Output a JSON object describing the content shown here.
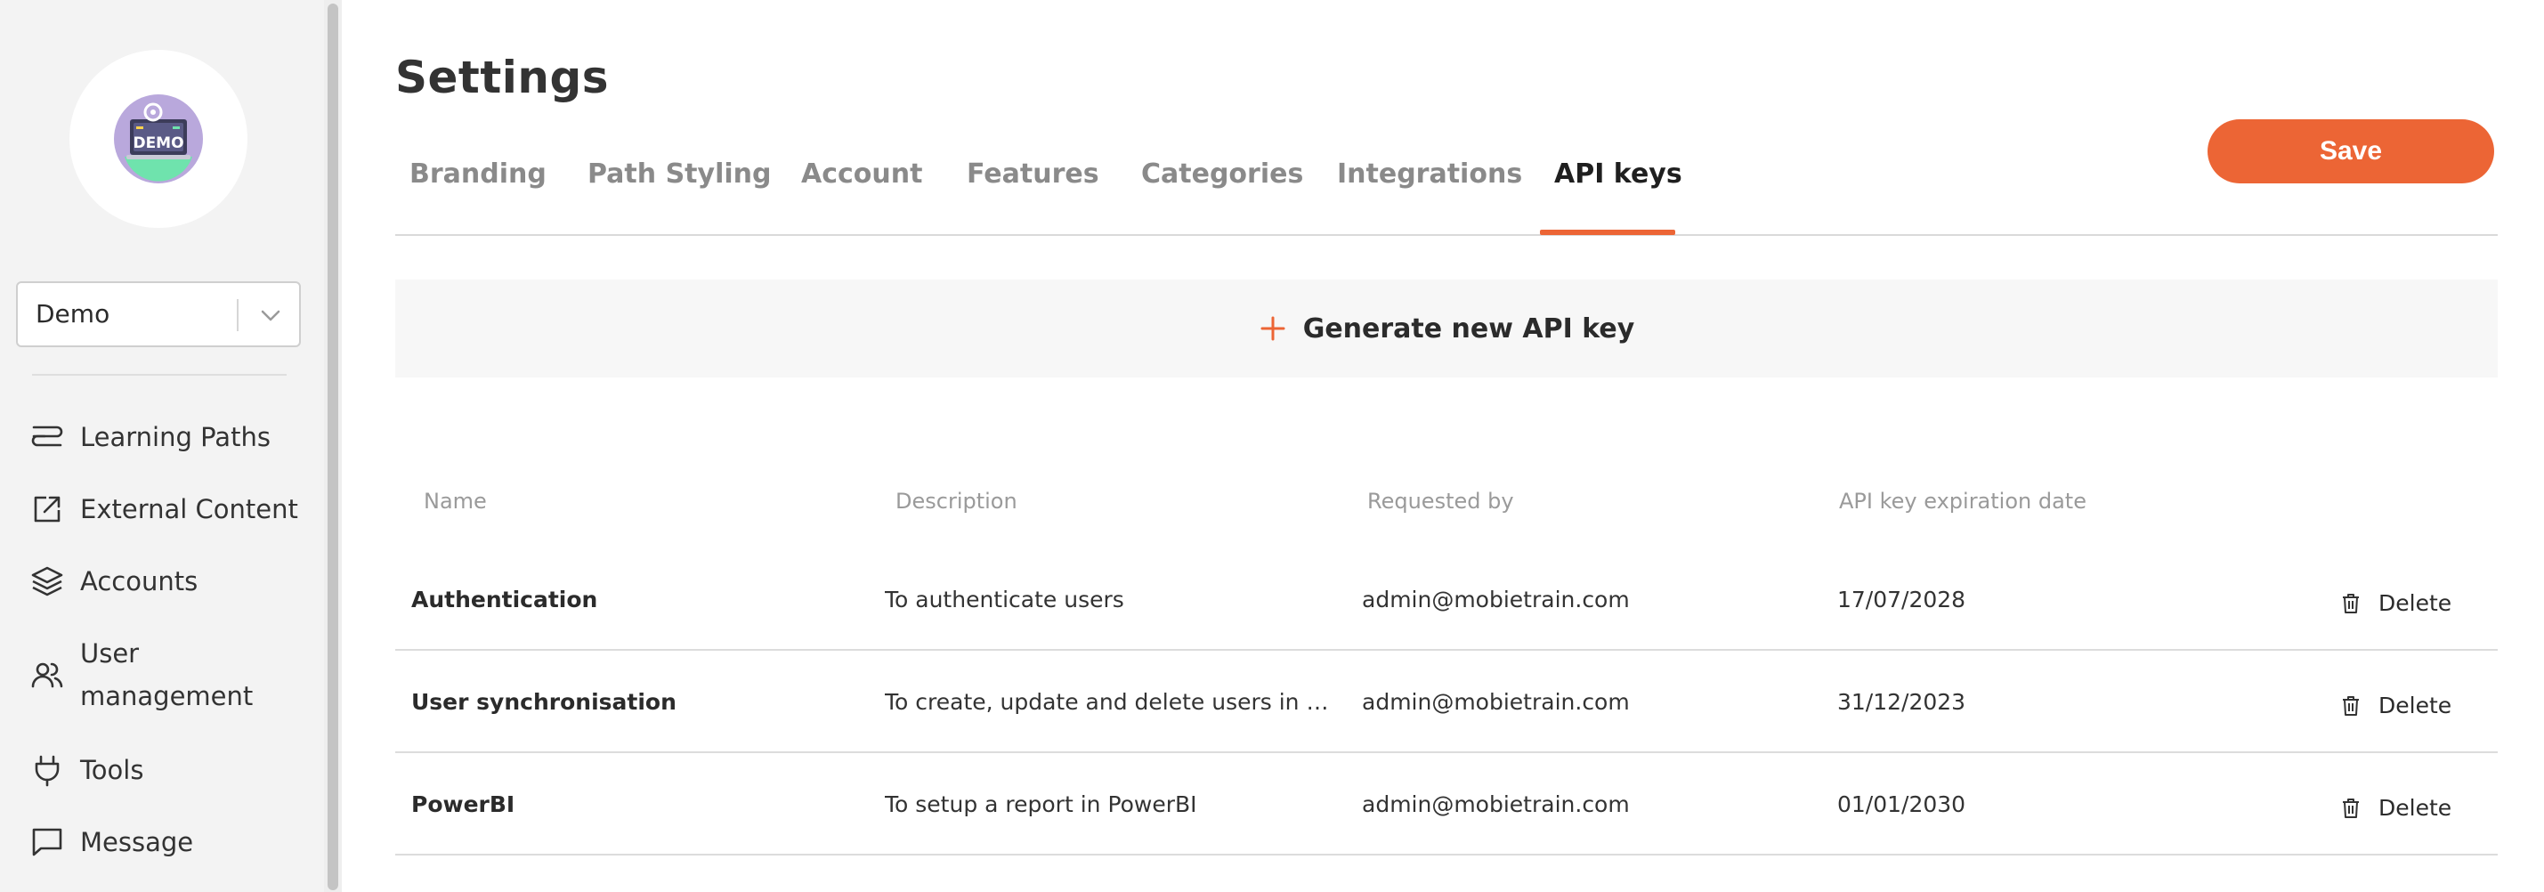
{
  "sidebar": {
    "logo_text": "DEMO",
    "workspace": {
      "selected": "Demo"
    },
    "items": [
      {
        "label": "Learning Paths",
        "icon": "learning-paths-icon"
      },
      {
        "label": "External Content",
        "icon": "external-link-icon"
      },
      {
        "label": "Accounts",
        "icon": "layers-icon"
      },
      {
        "label": "User management",
        "label_line1": "User",
        "label_line2": "management",
        "icon": "users-icon"
      },
      {
        "label": "Tools",
        "icon": "plug-icon"
      },
      {
        "label": "Message",
        "icon": "message-icon"
      }
    ]
  },
  "header": {
    "title": "Settings",
    "save_label": "Save"
  },
  "tabs": [
    {
      "label": "Branding",
      "active": false
    },
    {
      "label": "Path Styling",
      "active": false
    },
    {
      "label": "Account",
      "active": false
    },
    {
      "label": "Features",
      "active": false
    },
    {
      "label": "Categories",
      "active": false
    },
    {
      "label": "Integrations",
      "active": false
    },
    {
      "label": "API keys",
      "active": true
    }
  ],
  "api_keys": {
    "generate_label": "Generate new API key",
    "columns": {
      "name": "Name",
      "description": "Description",
      "requested_by": "Requested by",
      "expiration": "API key expiration date"
    },
    "delete_label": "Delete",
    "rows": [
      {
        "name": "Authentication",
        "description": "To authenticate users",
        "requested_by": "admin@mobietrain.com",
        "expiration": "17/07/2028"
      },
      {
        "name": "User synchronisation",
        "description": "To create, update and delete users in Mobietrain",
        "requested_by": "admin@mobietrain.com",
        "expiration": "31/12/2023"
      },
      {
        "name": "PowerBI",
        "description": "To setup a report in PowerBI",
        "requested_by": "admin@mobietrain.com",
        "expiration": "01/01/2030"
      }
    ]
  },
  "colors": {
    "accent": "#ec6535",
    "sidebar_bg": "#f3f3f3",
    "muted_text": "#8a8a8a"
  }
}
